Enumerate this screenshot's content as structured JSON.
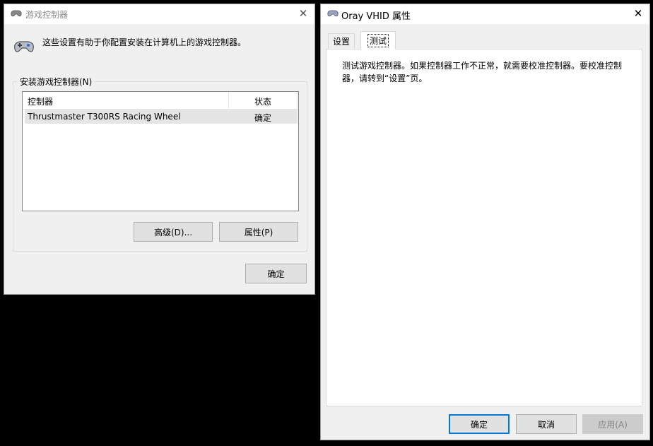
{
  "game_controllers_dialog": {
    "title": "游戏控制器",
    "description": "这些设置有助于你配置安装在计算机上的游戏控制器。",
    "group_label": "安装游戏控制器(N)",
    "columns": [
      "控制器",
      "状态"
    ],
    "rows": [
      {
        "controller": "Thrustmaster T300RS Racing Wheel",
        "status": "确定"
      }
    ],
    "advanced_button": "高级(D)...",
    "properties_button": "属性(P)",
    "ok_button": "确定"
  },
  "properties_dialog": {
    "title": "Oray VHID 属性",
    "tabs": [
      "设置",
      "测试"
    ],
    "active_tab": "测试",
    "test_description": "测试游戏控制器。如果控制器工作不正常，就需要校准控制器。要校准控制器，请转到“设置”页。",
    "ok_button": "确定",
    "cancel_button": "取消",
    "apply_button": "应用(A)"
  },
  "colors": {
    "desktop_background": "#000000",
    "dialog_background": "#f0f0f0",
    "default_button_border": "#0078d7",
    "selected_row": "#e5e5e5"
  }
}
